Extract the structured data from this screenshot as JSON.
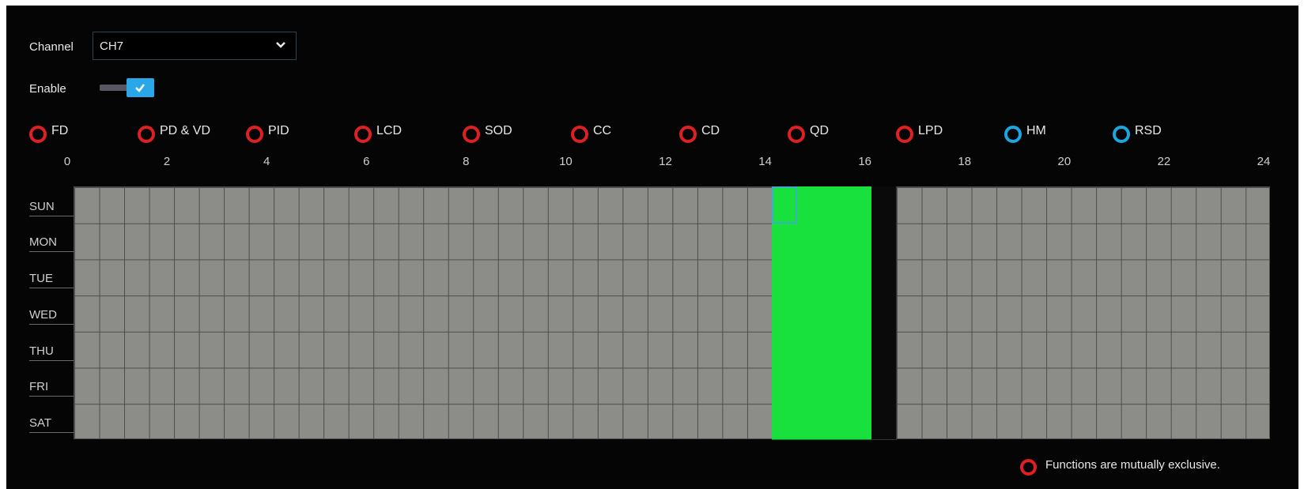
{
  "channel": {
    "label": "Channel",
    "value": "CH7"
  },
  "enable": {
    "label": "Enable",
    "checked": true
  },
  "functions": [
    {
      "label": "FD",
      "color": "#e02020"
    },
    {
      "label": "PD & VD",
      "color": "#e02020"
    },
    {
      "label": "PID",
      "color": "#e02020"
    },
    {
      "label": "LCD",
      "color": "#e02020"
    },
    {
      "label": "SOD",
      "color": "#e02020"
    },
    {
      "label": "CC",
      "color": "#e02020"
    },
    {
      "label": "CD",
      "color": "#e02020"
    },
    {
      "label": "QD",
      "color": "#e02020"
    },
    {
      "label": "LPD",
      "color": "#e02020"
    },
    {
      "label": "HM",
      "color": "#1aa6e0"
    },
    {
      "label": "RSD",
      "color": "#1aa6e0"
    }
  ],
  "hours": [
    "0",
    "2",
    "4",
    "6",
    "8",
    "10",
    "12",
    "14",
    "16",
    "18",
    "20",
    "22",
    "24"
  ],
  "days": [
    "SUN",
    "MON",
    "TUE",
    "WED",
    "THU",
    "FRI",
    "SAT"
  ],
  "schedule": {
    "scheduled_color": "#18e03c",
    "scheduled_half_hours": [
      28,
      29,
      30,
      31
    ],
    "unscheduled_color": "#8c8c88",
    "dark_half_hours": [
      32
    ],
    "cursor": {
      "day": "SUN",
      "half_hour": 28
    }
  },
  "legend": {
    "text": "Functions are mutually exclusive.",
    "color": "#e02020"
  }
}
